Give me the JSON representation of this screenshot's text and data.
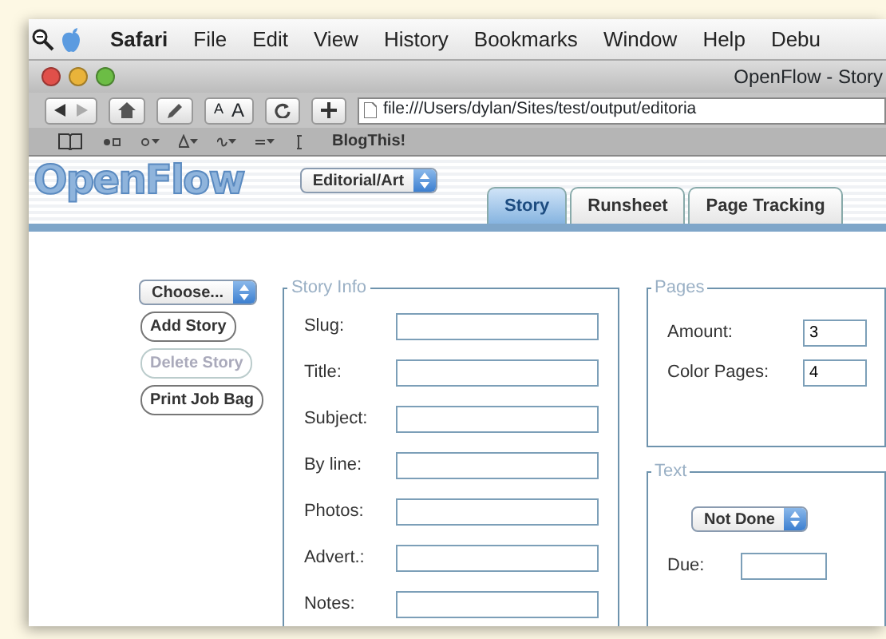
{
  "menu_bar": {
    "items": [
      {
        "label": "Safari",
        "kind": "app"
      },
      {
        "label": "File",
        "kind": "menu"
      },
      {
        "label": "Edit",
        "kind": "menu"
      },
      {
        "label": "View",
        "kind": "menu"
      },
      {
        "label": "History",
        "kind": "menu"
      },
      {
        "label": "Bookmarks",
        "kind": "menu"
      },
      {
        "label": "Window",
        "kind": "menu"
      },
      {
        "label": "Help",
        "kind": "menu"
      },
      {
        "label": "Debu",
        "kind": "menu"
      }
    ]
  },
  "window": {
    "title": "OpenFlow - Story"
  },
  "toolbar": {
    "text_size": [
      "A",
      "A"
    ],
    "address": "file:///Users/dylan/Sites/test/output/editoria"
  },
  "bookmarks_bar": {
    "items": [
      "BlogThis!"
    ]
  },
  "header": {
    "logo": "OpenFlow",
    "section": "Editorial/Art"
  },
  "tabs": [
    {
      "label": "Story",
      "selected": true
    },
    {
      "label": "Runsheet",
      "selected": false
    },
    {
      "label": "Page Tracking",
      "selected": false
    }
  ],
  "actions": {
    "chooser": "Choose...",
    "buttons": [
      {
        "label": "Add Story",
        "disabled": false
      },
      {
        "label": "Delete Story",
        "disabled": true
      },
      {
        "label": "Print Job Bag",
        "disabled": false
      }
    ]
  },
  "story_info": {
    "legend": "Story Info",
    "fields": [
      "Slug:",
      "Title:",
      "Subject:",
      "By line:",
      "Photos:",
      "Advert.:",
      "Notes:"
    ]
  },
  "pages": {
    "legend": "Pages",
    "fields": [
      {
        "label": "Amount:",
        "value": "3"
      },
      {
        "label": "Color Pages:",
        "value": "4"
      }
    ]
  },
  "text": {
    "legend": "Text",
    "status": "Not Done",
    "due_label": "Due:"
  }
}
